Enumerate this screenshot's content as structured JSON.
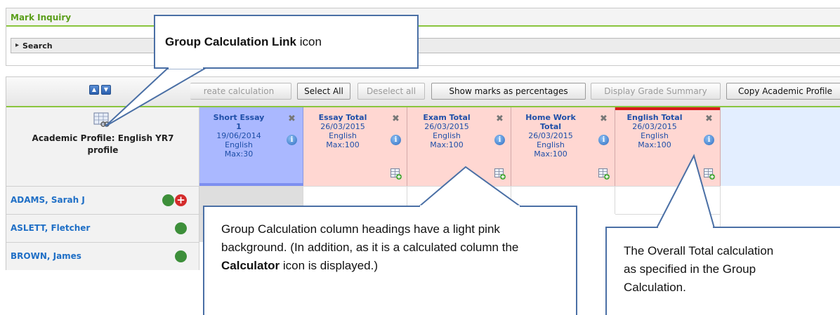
{
  "mark_inquiry": {
    "title": "Mark Inquiry",
    "search_label": "Search"
  },
  "toolbar": {
    "buttons": [
      {
        "label": "Create calculation",
        "display": "reate calculation",
        "enabled": false
      },
      {
        "label": "Select All",
        "enabled": true
      },
      {
        "label": "Deselect all",
        "enabled": false
      },
      {
        "label": "Show marks as percentages",
        "enabled": true
      },
      {
        "label": "Display Grade Summary",
        "enabled": false
      },
      {
        "label": "Copy Academic Profile",
        "enabled": true
      }
    ]
  },
  "profile": {
    "label_line1": "Academic Profile: English YR7",
    "label_line2": "profile"
  },
  "columns": [
    {
      "title": "Short Essay",
      "title2": "1",
      "date": "19/06/2014",
      "subject": "English",
      "max": "Max:30",
      "style": "blue",
      "calculated": false
    },
    {
      "title": "Essay Total",
      "date": "26/03/2015",
      "subject": "English",
      "max": "Max:100",
      "style": "pink",
      "calculated": true
    },
    {
      "title": "Exam Total",
      "date": "26/03/2015",
      "subject": "English",
      "max": "Max:100",
      "style": "pink",
      "calculated": true
    },
    {
      "title": "Home Work",
      "title2": "Total",
      "date": "26/03/2015",
      "subject": "English",
      "max": "Max:100",
      "style": "pink",
      "calculated": true
    },
    {
      "title": "English Total",
      "date": "26/03/2015",
      "subject": "English",
      "max": "Max:100",
      "style": "pink",
      "calculated": true,
      "overall": true
    }
  ],
  "students": [
    {
      "name": "ADAMS, Sarah J",
      "alert": true
    },
    {
      "name": "ASLETT, Fletcher",
      "alert": false
    },
    {
      "name": "BROWN, James",
      "alert": false
    }
  ],
  "callouts": {
    "link": {
      "bold": "Group Calculation Link",
      "rest": " icon"
    },
    "pink": {
      "part1": "Group Calculation column headings have a light pink background. (In addition, as it is a calculated column the ",
      "bold": "Calculator",
      "part2": " icon is displayed.)"
    },
    "total": {
      "text": "The Overall Total calculation as specified in the Group Calculation."
    }
  },
  "colors": {
    "pink_header": "#ffd7d2",
    "blue_header": "#aab8ff",
    "accent_green": "#8ac53e",
    "callout_border": "#4a6fa5",
    "overall_marker": "#d81b1b"
  }
}
